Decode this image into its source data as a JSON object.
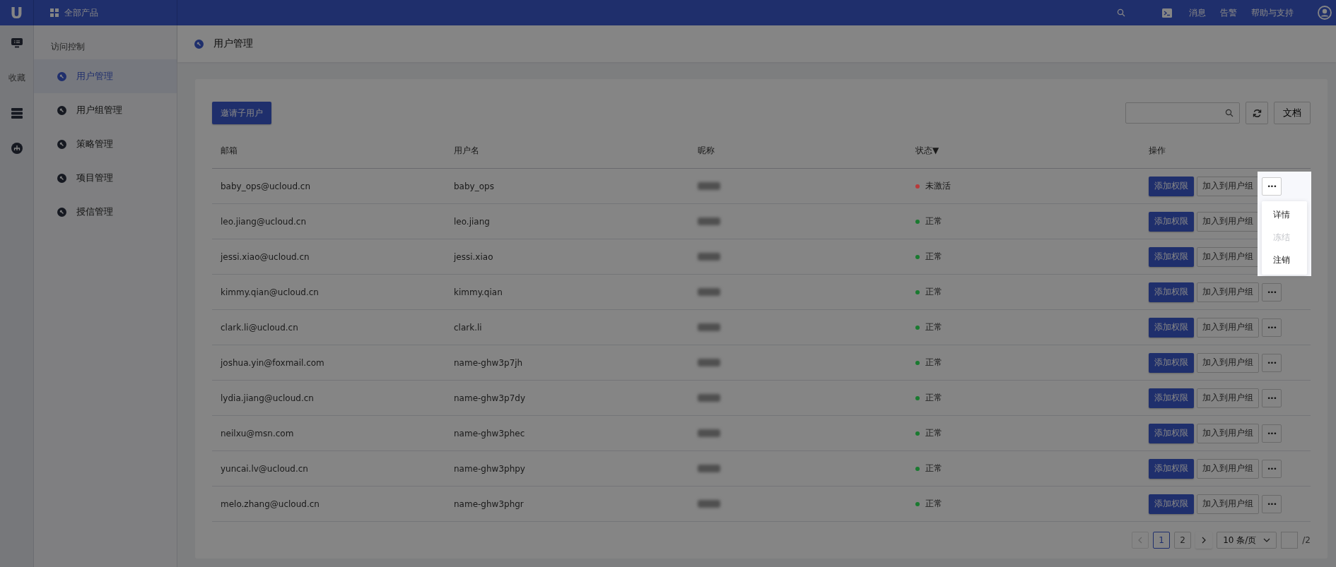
{
  "top_bar": {
    "logo": "U",
    "products": "全部产品",
    "links": [
      "消息",
      "告警",
      "帮助与支持"
    ]
  },
  "rail": {
    "favorites": "收藏"
  },
  "sidebar": {
    "heading": "访问控制",
    "items": [
      {
        "label": "用户管理",
        "selected": true
      },
      {
        "label": "用户组管理",
        "selected": false
      },
      {
        "label": "策略管理",
        "selected": false
      },
      {
        "label": "项目管理",
        "selected": false
      },
      {
        "label": "授信管理",
        "selected": false
      }
    ]
  },
  "page_title": "用户管理",
  "toolbar": {
    "invite_button": "邀请子用户",
    "docs_button": "文档"
  },
  "table": {
    "columns": [
      "邮箱",
      "用户名",
      "昵称",
      "状态▼",
      "操作"
    ],
    "rows": [
      {
        "email": "baby_ops@ucloud.cn",
        "username": "baby_ops",
        "status": "未激活",
        "color": "#b83a3a",
        "menu_open": true,
        "grant": "添加权限",
        "add_to_group": "加入到用户组",
        "more": "•••"
      },
      {
        "email": "leo.jiang@ucloud.cn",
        "username": "leo.jiang",
        "status": "正常",
        "color": "#1a7a30",
        "grant": "添加权限",
        "add_to_group": "加入到用户组"
      },
      {
        "email": "jessi.xiao@ucloud.cn",
        "username": "jessi.xiao",
        "status": "正常",
        "color": "#1a7a30",
        "grant": "添加权限",
        "add_to_group": "加入到用户组"
      },
      {
        "email": "kimmy.qian@ucloud.cn",
        "username": "kimmy.qian",
        "status": "正常",
        "color": "#1a7a30",
        "menu_open": false,
        "grant": "添加权限",
        "add_to_group": "加入到用户组",
        "more": "•••"
      },
      {
        "email": "clark.li@ucloud.cn",
        "username": "clark.li",
        "status": "正常",
        "color": "#1a7a30",
        "menu_open": false,
        "grant": "添加权限",
        "add_to_group": "加入到用户组",
        "more": "•••"
      },
      {
        "email": "joshua.yin@foxmail.com",
        "username": "name-ghw3p7jh",
        "status": "正常",
        "color": "#1a7a30",
        "menu_open": false,
        "grant": "添加权限",
        "add_to_group": "加入到用户组",
        "more": "•••"
      },
      {
        "email": "lydia.jiang@ucloud.cn",
        "username": "name-ghw3p7dy",
        "status": "正常",
        "color": "#1a7a30",
        "menu_open": false,
        "grant": "添加权限",
        "add_to_group": "加入到用户组",
        "more": "•••"
      },
      {
        "email": "neilxu@msn.com",
        "username": "name-ghw3phec",
        "status": "正常",
        "color": "#1a7a30",
        "menu_open": false,
        "grant": "添加权限",
        "add_to_group": "加入到用户组",
        "more": "•••"
      },
      {
        "email": "yuncai.lv@ucloud.cn",
        "username": "name-ghw3phpy",
        "status": "正常",
        "color": "#1a7a30",
        "menu_open": false,
        "grant": "添加权限",
        "add_to_group": "加入到用户组",
        "more": "•••"
      },
      {
        "email": "melo.zhang@ucloud.cn",
        "username": "name-ghw3phgr",
        "status": "正常",
        "color": "#1a7a30",
        "menu_open": false,
        "grant": "添加权限",
        "add_to_group": "加入到用户组",
        "more": "•••"
      }
    ],
    "menu": [
      {
        "label": "详情",
        "disabled": false
      },
      {
        "label": "冻结",
        "disabled": true
      },
      {
        "label": "注销",
        "disabled": false
      }
    ]
  },
  "pagination": {
    "pages": [
      {
        "label": "1",
        "selected": true
      },
      {
        "label": "2",
        "selected": false
      }
    ],
    "page_size": "10 条/页",
    "total": "/2"
  }
}
